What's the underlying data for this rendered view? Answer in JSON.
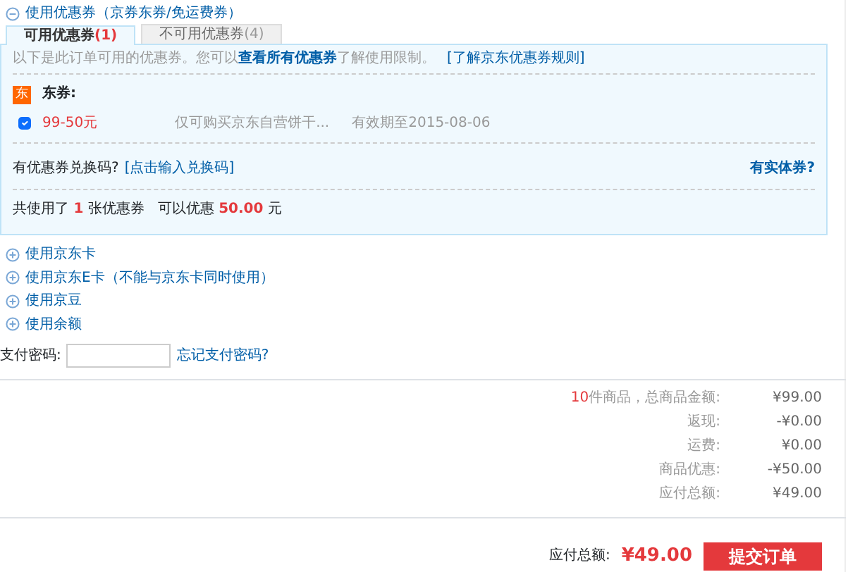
{
  "section_header": {
    "label": "使用优惠券（京券东券/免运费券）",
    "expanded": true
  },
  "tabs": [
    {
      "label": "可用优惠券",
      "count": "(1)",
      "selected": true
    },
    {
      "label": "不可用优惠券",
      "count": "(4)",
      "selected": false
    }
  ],
  "coupon_panel": {
    "intro": "以下是此订单可用的优惠券。您可以",
    "intro_link": "查看所有优惠券",
    "intro_tail": "了解使用限制。",
    "rules_link": "[了解京东优惠券规则]",
    "group": {
      "badge": "东",
      "title": "东券:"
    },
    "coupons": [
      {
        "checked": true,
        "name": "99-50元",
        "scope": "仅可购买京东自营饼干...",
        "validity": "有效期至2015-08-06"
      }
    ],
    "code_prompt": "有优惠券兑换码?",
    "code_link": "[点击输入兑换码]",
    "physical_link": "有实体券?",
    "summary": "共使用了 **1** 张优惠券   可以优惠 **50.00** 元"
  },
  "options": [
    {
      "label": "使用京东卡",
      "expanded": false
    },
    {
      "label": "使用京东E卡（不能与京东卡同时使用）",
      "expanded": false
    },
    {
      "label": "使用京豆",
      "expanded": false
    },
    {
      "label": "使用余额",
      "expanded": false
    }
  ],
  "password": {
    "label": "支付密码:",
    "forgot_link": "忘记支付密码?"
  },
  "totals": [
    {
      "count": "10",
      "label": "件商品，总商品金额:",
      "value": "¥99.00"
    },
    {
      "label": "返现:",
      "value": "-¥0.00"
    },
    {
      "label": "运费:",
      "value": "¥0.00"
    },
    {
      "label": "商品优惠:",
      "value": "-¥50.00"
    },
    {
      "label": "应付总额:",
      "value": "¥49.00"
    }
  ],
  "footer": {
    "label": "应付总额:",
    "amount": "¥49.00",
    "submit": "提交订单"
  }
}
